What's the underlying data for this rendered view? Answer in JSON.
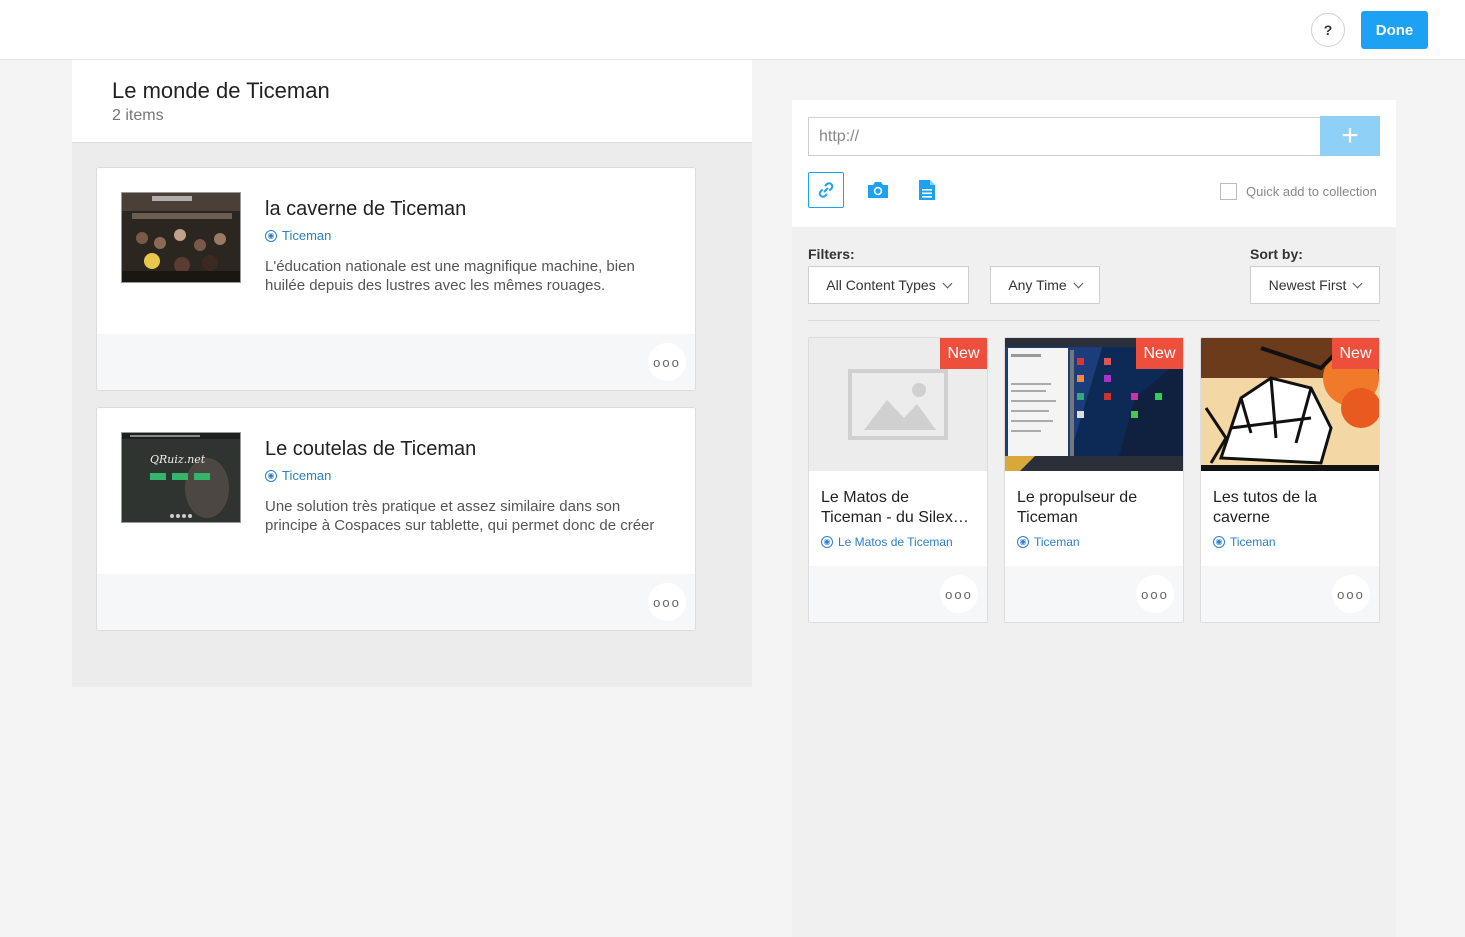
{
  "header": {
    "help_label": "?",
    "done_label": "Done"
  },
  "collection": {
    "title": "Le monde de Ticeman",
    "count": "2 items",
    "items": [
      {
        "title": "la caverne de Ticeman",
        "source": "Ticeman",
        "description": "L'éducation nationale est une magnifique machine, bien huilée depuis des lustres avec les mêmes rouages.",
        "more_label": "ooo"
      },
      {
        "title": "Le coutelas de Ticeman",
        "source": "Ticeman",
        "description": "Une solution très pratique et assez similaire dans son principe à Cospaces sur tablette, qui permet donc de créer",
        "more_label": "ooo"
      }
    ]
  },
  "search": {
    "url_placeholder": "http://",
    "add_label": "+",
    "quick_add_label": "Quick add to collection",
    "filters_label": "Filters:",
    "sort_label": "Sort by:",
    "content_type_value": "All Content Types",
    "time_value": "Any Time",
    "sort_value": "Newest First"
  },
  "results": [
    {
      "title_line1": "Le Matos de",
      "title_line2": "Ticeman - du Silex…",
      "source": "Le Matos de Ticeman",
      "badge": "New",
      "more_label": "ooo"
    },
    {
      "title_line1": "Le propulseur de",
      "title_line2": "Ticeman",
      "source": "Ticeman",
      "badge": "New",
      "more_label": "ooo"
    },
    {
      "title_line1": "Les tutos de la",
      "title_line2": "caverne",
      "source": "Ticeman",
      "badge": "New",
      "more_label": "ooo"
    }
  ],
  "icons": {
    "help": "question-icon",
    "link": "link-icon",
    "camera": "camera-icon",
    "document": "document-icon",
    "globe": "globe-icon",
    "placeholder": "image-placeholder-icon"
  },
  "colors": {
    "accent": "#1da1f2",
    "badge": "#ee4f3d",
    "link": "#2c7fc9"
  }
}
